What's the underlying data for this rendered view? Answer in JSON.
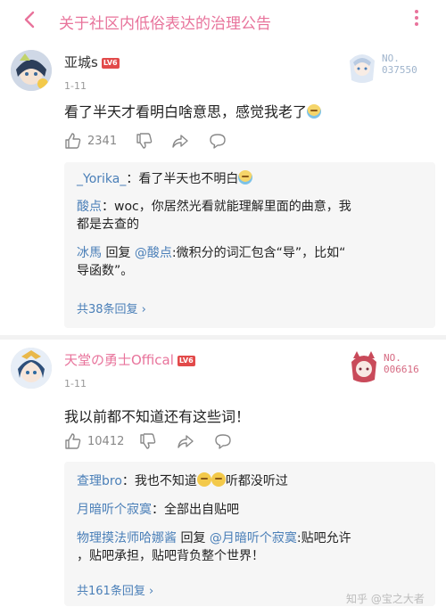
{
  "header": {
    "title": "关于社区内低俗表达的治理公告"
  },
  "comments": [
    {
      "username": "亚城s",
      "level": "LV6",
      "date": "1-11",
      "text": "看了半天才看明白啥意思，感觉我老了",
      "badge_no": "NO.\n037550",
      "likes": "2341",
      "replies": [
        {
          "user": "_Yorika_",
          "sep": "：",
          "text": "看了半天也不明白"
        },
        {
          "user": "酸点",
          "sep": "：",
          "text1": "woc，你居然光看就能理解里面的曲意，我",
          "text2": "都是去查的"
        },
        {
          "user": "冰馬",
          "reply_word": "回复",
          "at_user": "@酸点",
          "text1": ":微积分的词汇包含“导”，比如“",
          "text2": "导函数”。"
        }
      ],
      "more_replies": "共38条回复 ›"
    },
    {
      "username": "天堂の勇士Offical",
      "level": "LV6",
      "date": "1-11",
      "text": "我以前都不知道还有这些词！",
      "badge_no": "NO.\n006616",
      "likes": "10412",
      "replies": [
        {
          "user": "查理bro",
          "sep": "：",
          "text_a": "我也不知道",
          "text_b": "听都没听过"
        },
        {
          "user": "月暗听个寂寞",
          "sep": "：",
          "text": "全部出自贴吧"
        },
        {
          "user": "物理摸法师哈娜酱",
          "reply_word": "回复",
          "at_user": "@月暗听个寂寞",
          "text1": ":贴吧允许",
          "text2": "，贴吧承担，贴吧背负整个世界！"
        }
      ],
      "more_replies": "共161条回复 ›"
    }
  ],
  "watermark": "知乎 @宝之大者",
  "colors": {
    "accent": "#e8739b",
    "link": "#4a7fb8",
    "level_badge": "#e24a4a"
  },
  "icons": [
    "back-icon",
    "more-icon",
    "like-icon",
    "dislike-icon",
    "share-icon",
    "reply-icon"
  ]
}
